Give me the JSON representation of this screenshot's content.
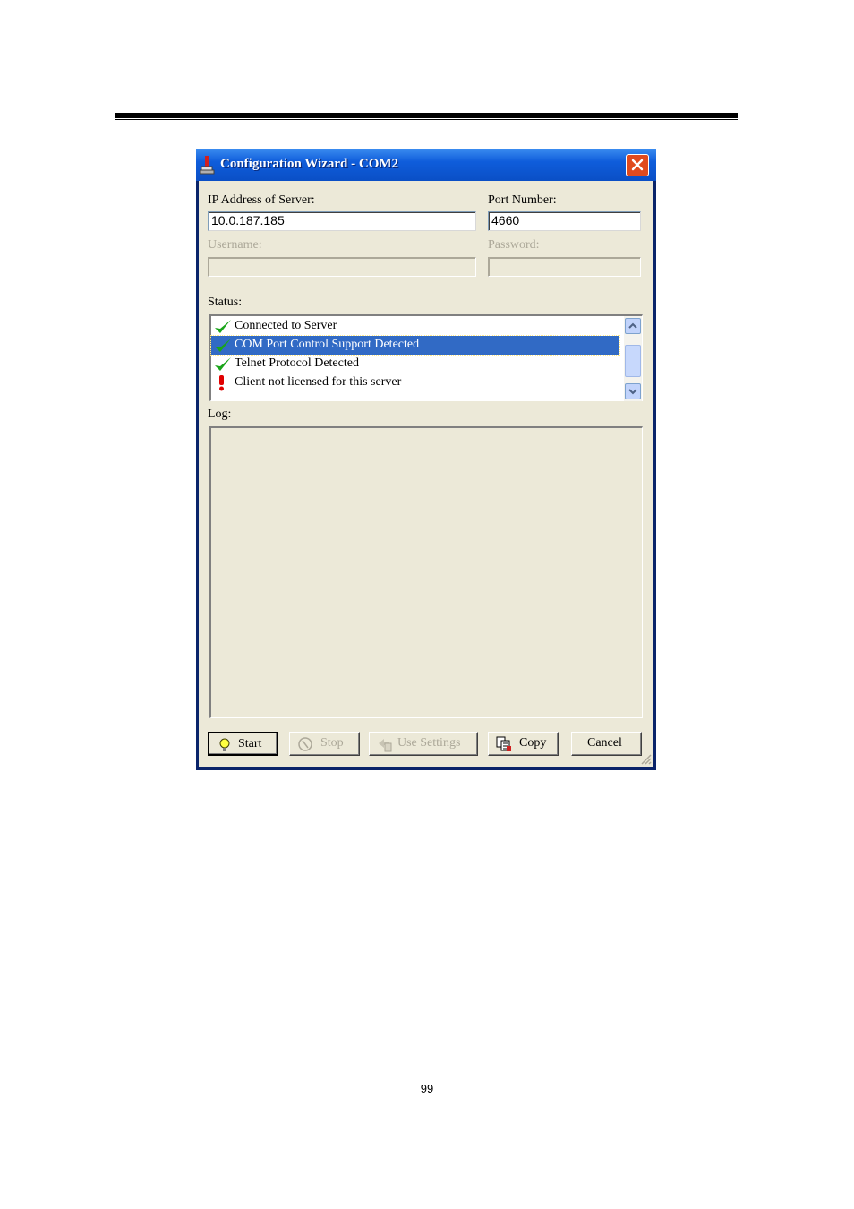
{
  "window": {
    "title": "Configuration Wizard - COM2"
  },
  "form": {
    "ip_label": "IP Address of Server:",
    "ip_value": "10.0.187.185",
    "port_label": "Port Number:",
    "port_value": "4660",
    "username_label": "Username:",
    "username_value": "",
    "password_label": "Password:",
    "password_value": ""
  },
  "status": {
    "label": "Status:",
    "items": [
      {
        "icon": "check-icon",
        "text": "Connected to Server"
      },
      {
        "icon": "check-icon",
        "text": "COM Port Control Support Detected",
        "selected": true
      },
      {
        "icon": "check-icon",
        "text": "Telnet Protocol Detected"
      },
      {
        "icon": "exclamation-icon",
        "text": "Client not licensed for this server"
      }
    ]
  },
  "log": {
    "label": "Log:"
  },
  "buttons": {
    "start": "Start",
    "stop": "Stop",
    "use_settings": "Use Settings",
    "copy": "Copy",
    "cancel": "Cancel"
  },
  "colors": {
    "titlebar": "#0a4fc6",
    "selection": "#316ac5",
    "check": "#1aa51a",
    "error": "#e00000"
  },
  "page": {
    "number": "99"
  }
}
